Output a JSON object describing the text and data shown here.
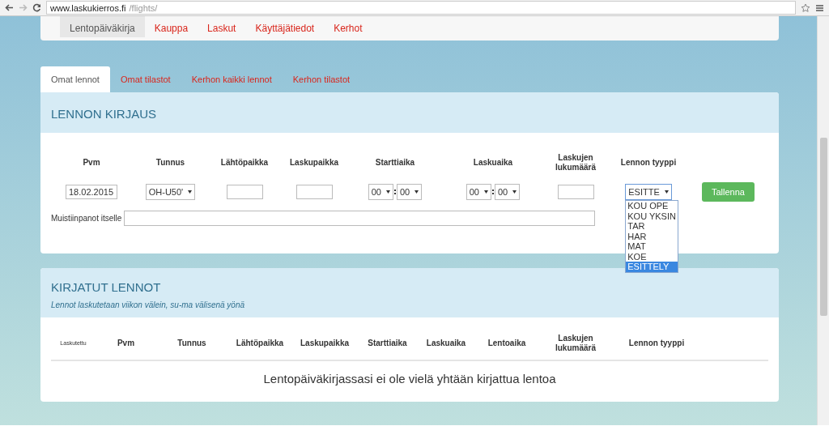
{
  "browser": {
    "url_host": "www.laskukierros.fi",
    "url_path": "/flights/"
  },
  "nav": [
    {
      "label": "Lentopäiväkirja",
      "selected": true
    },
    {
      "label": "Kauppa",
      "selected": false
    },
    {
      "label": "Laskut",
      "selected": false
    },
    {
      "label": "Käyttäjätiedot",
      "selected": false
    },
    {
      "label": "Kerhot",
      "selected": false
    }
  ],
  "tabs": [
    {
      "label": "Omat lennot",
      "selected": true
    },
    {
      "label": "Omat tilastot",
      "selected": false
    },
    {
      "label": "Kerhon kaikki lennot",
      "selected": false
    },
    {
      "label": "Kerhon tilastot",
      "selected": false
    }
  ],
  "entry": {
    "title": "LENNON KIRJAUS",
    "columns": [
      {
        "label": "Pvm",
        "kind": "text",
        "value": "18.02.2015"
      },
      {
        "label": "Tunnus",
        "kind": "select",
        "value": "OH-U50'"
      },
      {
        "label": "Lähtöpaikka",
        "kind": "text"
      },
      {
        "label": "Laskupaikka",
        "kind": "text"
      },
      {
        "label": "Starttiaika",
        "kind": "time",
        "hours": "00",
        "minutes": "00"
      },
      {
        "label": "Laskuaika",
        "kind": "time",
        "hours": "00",
        "minutes": "00"
      },
      {
        "label": "Laskujen lukumäärä",
        "kind": "text"
      },
      {
        "label": "Lennon tyyppi",
        "kind": "dropdown",
        "value": "ESITTE",
        "expanded": true,
        "options": [
          {
            "label": "KOU OPE",
            "selected": false
          },
          {
            "label": "KOU YKSIN",
            "selected": false
          },
          {
            "label": "TAR",
            "selected": false
          },
          {
            "label": "HAR",
            "selected": false
          },
          {
            "label": "MAT",
            "selected": false
          },
          {
            "label": "KOE",
            "selected": false
          },
          {
            "label": "ESITTELY",
            "selected": true
          }
        ]
      }
    ],
    "save_button": "Tallenna",
    "notes_label": "Muistiinpanot itselle"
  },
  "flights": {
    "title": "KIRJATUT LENNOT",
    "subtitle": "Lennot laskutetaan viikon välein, su-ma välisenä yönä",
    "columns": [
      "Laskutettu",
      "Pvm",
      "Tunnus",
      "Lähtöpaikka",
      "Laskupaikka",
      "Starttiaika",
      "Laskuaika",
      "Lentoaika",
      "Laskujen lukumäärä",
      "Lennon tyyppi"
    ],
    "empty_message": "Lentopäiväkirjassasi ei ole vielä yhtään kirjattua lentoa"
  }
}
